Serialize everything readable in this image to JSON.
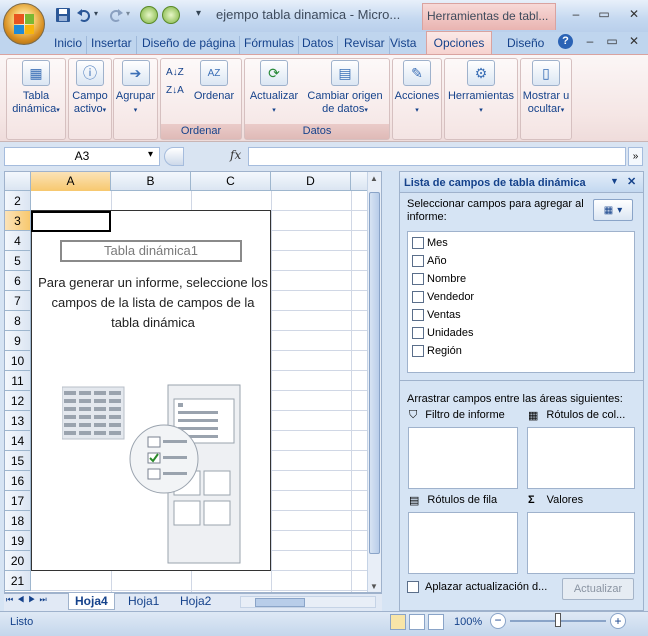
{
  "window": {
    "title": "ejempo tabla dinamica - Micro...",
    "tools_tab": "Herramientas de tabl...",
    "controls": [
      "–",
      "▭",
      "✕"
    ],
    "ribbon_controls": [
      "–",
      "▭",
      "✕"
    ]
  },
  "tabs": [
    "Inicio",
    "Insertar",
    "Diseño de página",
    "Fórmulas",
    "Datos",
    "Revisar",
    "Vista",
    "Opciones",
    "Diseño"
  ],
  "active_tab": "Opciones",
  "ribbon": {
    "buttons": [
      {
        "label1": "Tabla",
        "label2": "dinámica",
        "arrow": "▾",
        "icon": "▦"
      },
      {
        "label1": "Campo",
        "label2": "activo",
        "arrow": "▾",
        "icon": "ⓘ"
      },
      {
        "label1": "Agrupar",
        "label2": "",
        "arrow": "▾",
        "icon": "➔"
      },
      {
        "label1": "Ordenar",
        "label2": "",
        "arrow": "",
        "icon": "AZ"
      },
      {
        "label1": "Actualizar",
        "label2": "",
        "arrow": "▾",
        "icon": "⟳"
      },
      {
        "label1": "Cambiar origen",
        "label2": "de datos",
        "arrow": "▾",
        "icon": "▤"
      },
      {
        "label1": "Acciones",
        "label2": "",
        "arrow": "▾",
        "icon": "✎"
      },
      {
        "label1": "Herramientas",
        "label2": "",
        "arrow": "▾",
        "icon": "⚙"
      },
      {
        "label1": "Mostrar u",
        "label2": "ocultar",
        "arrow": "▾",
        "icon": "▯"
      }
    ],
    "groups": [
      "Ordenar",
      "Datos"
    ],
    "sort_glyphs": [
      "A↓Z",
      "Z↓A"
    ]
  },
  "formula_bar": {
    "name_box": "A3",
    "fx_label": "fx",
    "dropdown": "▾",
    "expand": "»"
  },
  "grid": {
    "columns": [
      "A",
      "B",
      "C",
      "D"
    ],
    "rows": [
      "2",
      "3",
      "4",
      "5",
      "6",
      "7",
      "8",
      "9",
      "10",
      "11",
      "12",
      "13",
      "14",
      "15",
      "16",
      "17",
      "18",
      "19",
      "20",
      "21"
    ],
    "selected_cell": "A3"
  },
  "pivot": {
    "name": "Tabla dinámica1",
    "message": "Para generar un informe, seleccione los campos de la lista de campos de la tabla dinámica"
  },
  "sheets": {
    "tabs": [
      "Hoja4",
      "Hoja1",
      "Hoja2"
    ],
    "active": "Hoja4",
    "nav": [
      "⏮",
      "◀",
      "▶",
      "⏭"
    ]
  },
  "pane": {
    "title": "Lista de campos de tabla dinámica",
    "instruction": "Seleccionar campos para agregar al informe:",
    "fields": [
      "Mes",
      "Año",
      "Nombre",
      "Vendedor",
      "Ventas",
      "Unidades",
      "Región"
    ],
    "drag_label": "Arrastrar campos entre las áreas siguientes:",
    "areas": {
      "filter": "Filtro de informe",
      "columns": "Rótulos de col...",
      "rows": "Rótulos de fila",
      "values": "Valores"
    },
    "defer_label": "Aplazar actualización d...",
    "update_button": "Actualizar",
    "header_controls": [
      "▼",
      "✕"
    ]
  },
  "status": {
    "text": "Listo",
    "zoom": "100%",
    "zoom_minus": "−",
    "zoom_plus": "+",
    "zoom_level": 0.5
  }
}
